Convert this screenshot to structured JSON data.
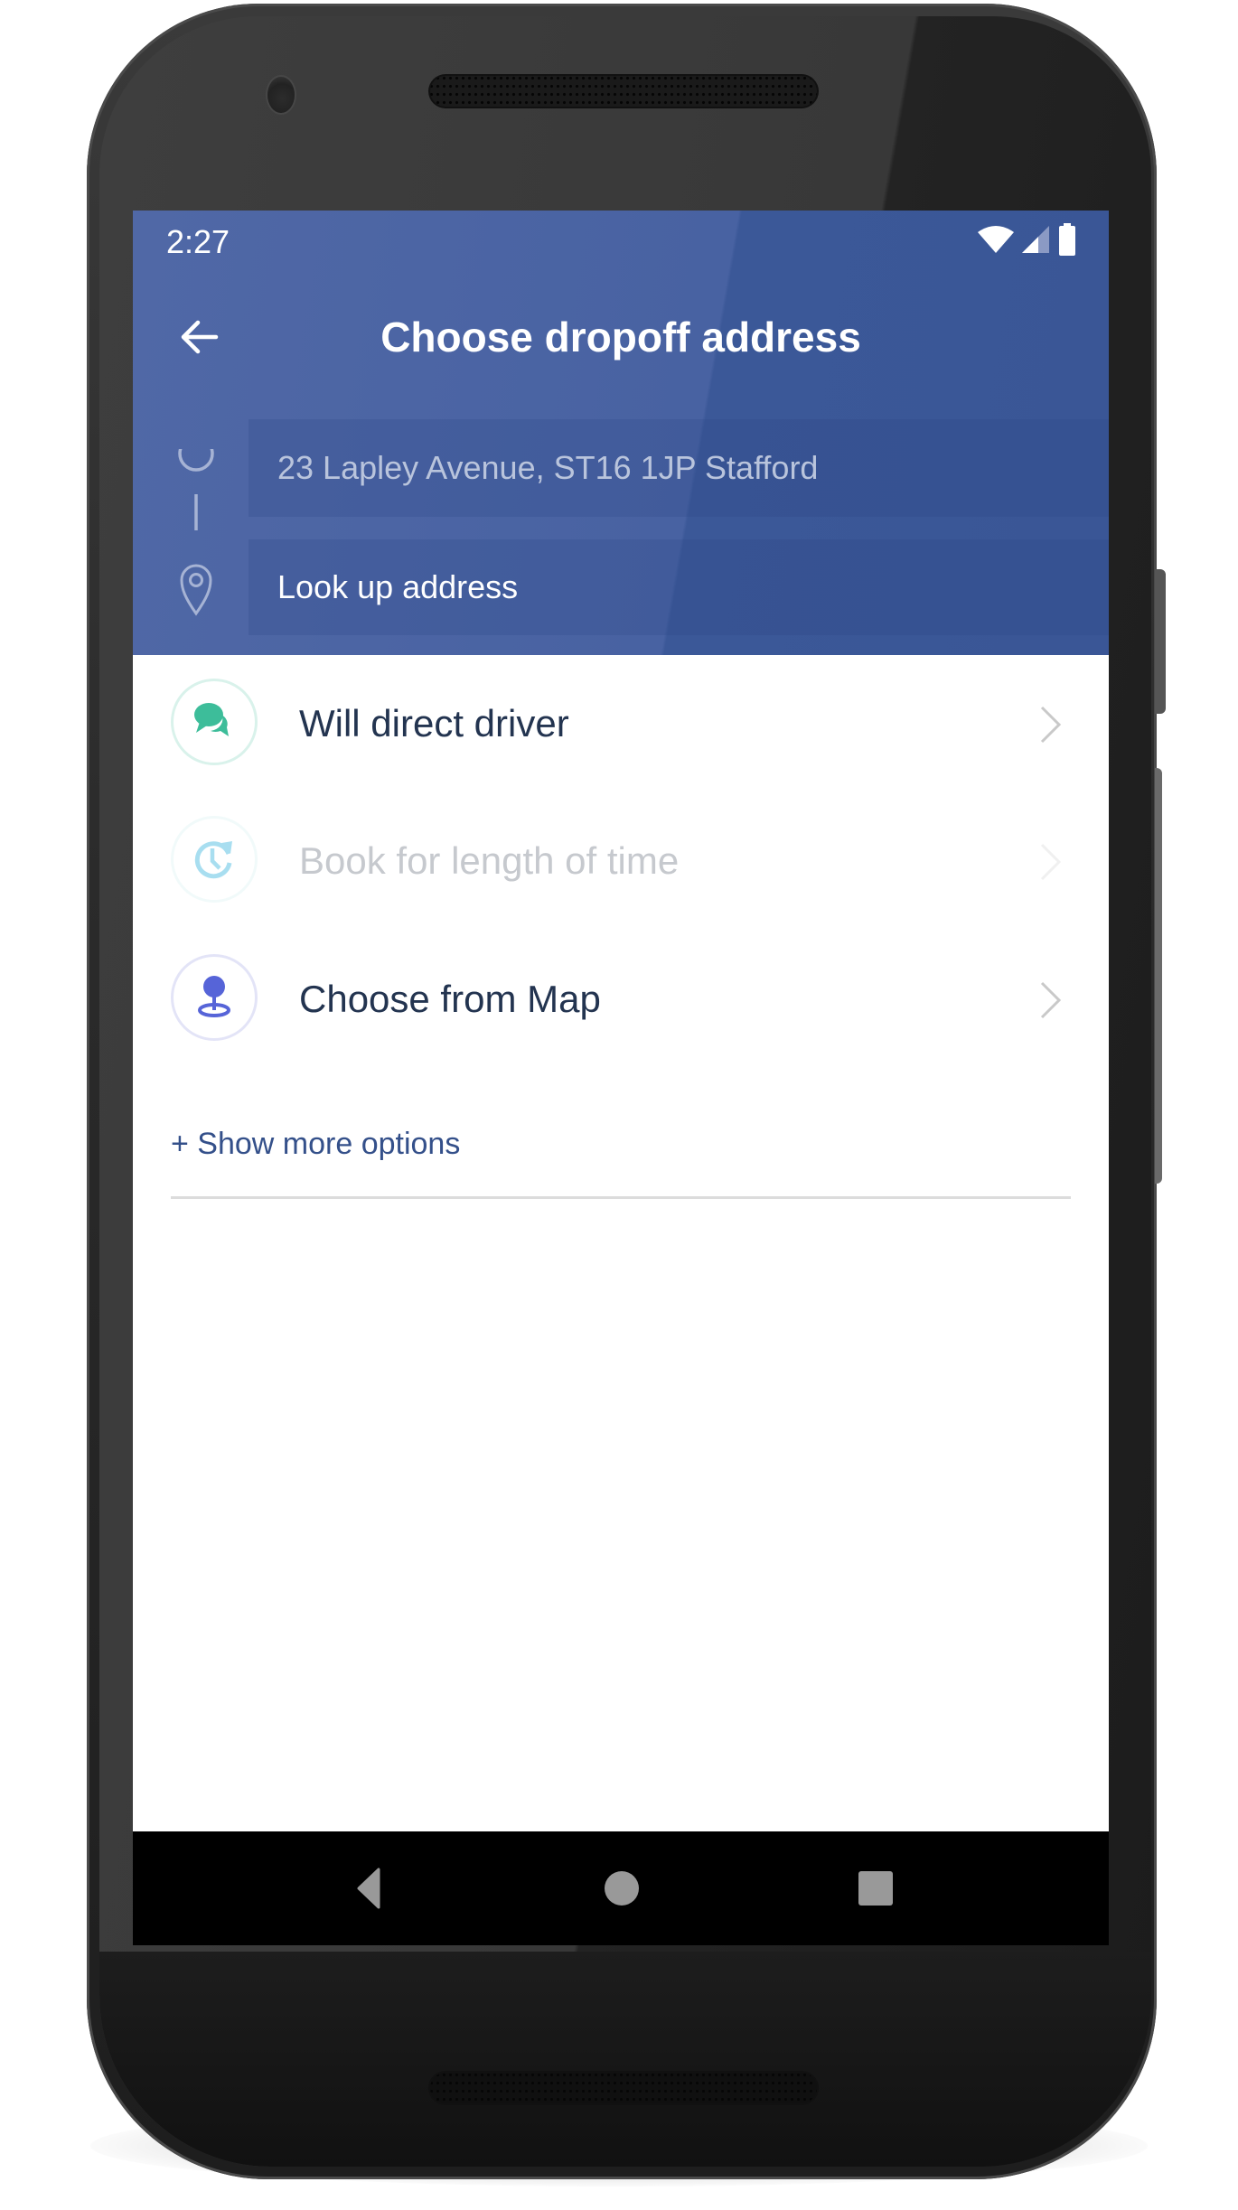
{
  "status_bar": {
    "time": "2:27",
    "icons": [
      "wifi-icon",
      "cell-signal-icon",
      "battery-icon"
    ]
  },
  "app_bar": {
    "back_icon": "arrow-left-icon",
    "title": "Choose dropoff address"
  },
  "route": {
    "pickup": {
      "icon": "circle-outline-icon",
      "value": "23 Lapley Avenue, ST16 1JP Stafford"
    },
    "dropoff": {
      "icon": "map-pin-icon",
      "placeholder": "Look up address",
      "value": "",
      "action_icon": "search-icon"
    }
  },
  "options": [
    {
      "label": "Will direct driver",
      "icon": "chat-bubbles-icon",
      "enabled": true,
      "color": "#3dbd9a"
    },
    {
      "label": "Book for length of time",
      "icon": "clock-refresh-icon",
      "enabled": false,
      "color": "#a8def0"
    },
    {
      "label": "Choose from Map",
      "icon": "map-marker-pin-icon",
      "enabled": true,
      "color": "#5664d8"
    }
  ],
  "show_more_label": "+ Show more options",
  "nav_bar": {
    "back": "nav-back-icon",
    "home": "nav-home-icon",
    "recents": "nav-recents-icon"
  },
  "colors": {
    "header": "#4862a2",
    "accent_text": "#34508a",
    "primary_text": "#233450",
    "disabled_text": "#c6c9ce"
  }
}
